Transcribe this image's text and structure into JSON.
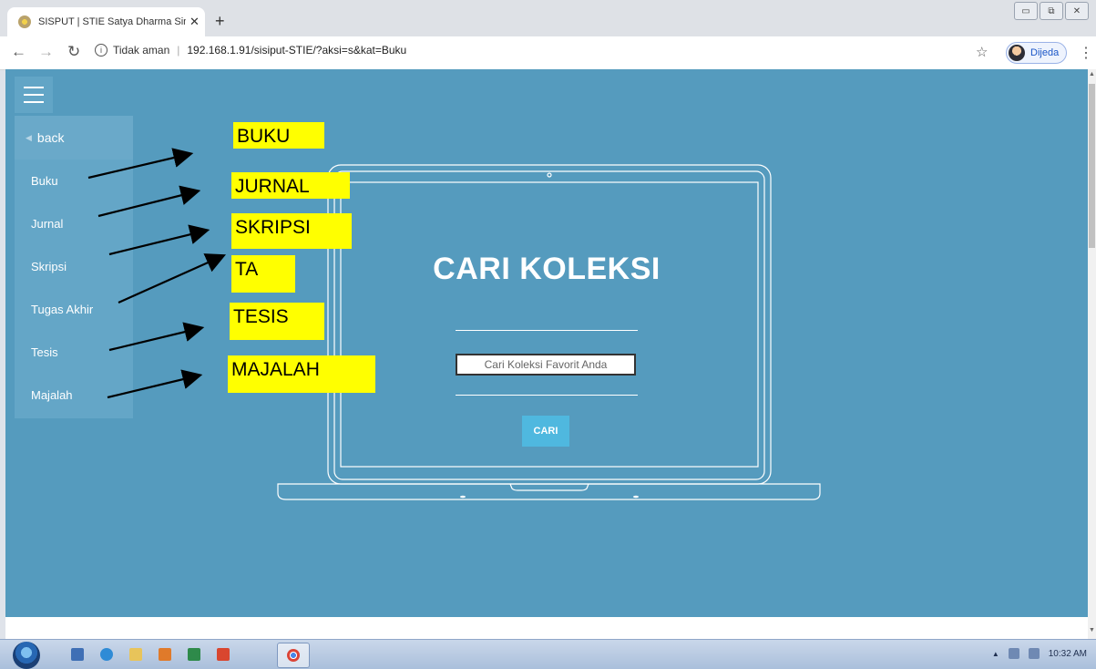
{
  "browser": {
    "tab_title": "SISPUT | STIE Satya Dharma Singa",
    "tab_close": "✕",
    "new_tab": "+",
    "address_security": "Tidak aman",
    "address_url": "192.168.1.91/sisiput-STIE/?aksi=s&kat=Buku",
    "profile_name": "Dijeda",
    "window_buttons": [
      "▭",
      "⧉",
      "✕"
    ]
  },
  "sidebar": {
    "back_label": "back",
    "items": [
      "Buku",
      "Jurnal",
      "Skripsi",
      "Tugas Akhir",
      "Tesis",
      "Majalah"
    ]
  },
  "hero": {
    "title": "CARI KOLEKSI",
    "search_placeholder": "Cari Koleksi Favorit Anda",
    "search_button": "CARI"
  },
  "annotations": [
    "BUKU",
    "JURNAL",
    "SKRIPSI",
    "TA",
    "TESIS",
    "MAJALAH"
  ],
  "taskbar": {
    "clock": "10:32 AM"
  },
  "colors": {
    "page_bg": "#559bbe",
    "sidebar_bg": "#64a6c7",
    "button_bg": "#4fb8df",
    "annotation_bg": "#ffff00"
  },
  "icons": [
    "favicon-icon",
    "back-arrow-icon",
    "forward-arrow-icon",
    "reload-icon",
    "info-icon",
    "star-icon",
    "menu-dots-icon",
    "hamburger-icon",
    "laptop-illustration"
  ]
}
